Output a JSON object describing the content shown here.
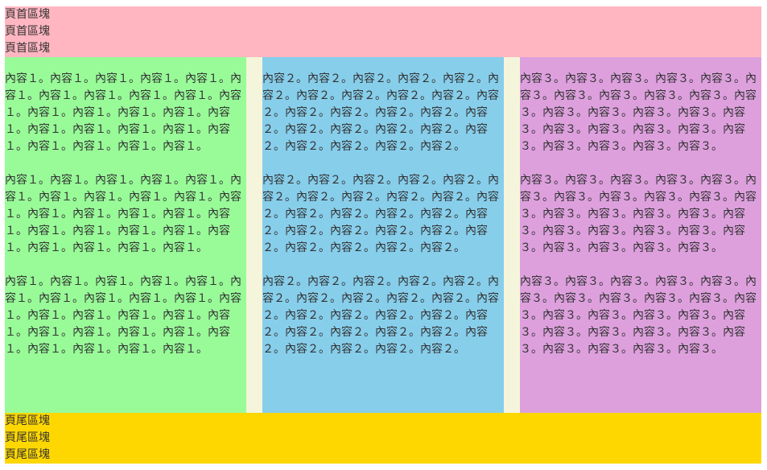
{
  "header": {
    "lines": [
      "頁首區塊",
      "頁首區塊",
      "頁首區塊"
    ],
    "color": "#ffb6c1"
  },
  "columns": [
    {
      "color": "#98fb98",
      "paragraphs": [
        "內容１。內容１。內容１。內容１。內容１。內容１。內容１。內容１。內容１。內容１。內容１。內容１。內容１。內容１。內容１。內容１。內容１。內容１。內容１。內容１。內容１。內容１。內容１。內容１。內容１。",
        "內容１。內容１。內容１。內容１。內容１。內容１。內容１。內容１。內容１。內容１。內容１。內容１。內容１。內容１。內容１。內容１。內容１。內容１。內容１。內容１。內容１。內容１。內容１。內容１。內容１。",
        "內容１。內容１。內容１。內容１。內容１。內容１。內容１。內容１。內容１。內容１。內容１。內容１。內容１。內容１。內容１。內容１。內容１。內容１。內容１。內容１。內容１。內容１。內容１。內容１。內容１。"
      ]
    },
    {
      "color": "#87ceeb",
      "paragraphs": [
        "內容２。內容２。內容２。內容２。內容２。內容２。內容２。內容２。內容２。內容２。內容２。內容２。內容２。內容２。內容２。內容２。內容２。內容２。內容２。內容２。內容２。內容２。內容２。內容２。內容２。",
        "內容２。內容２。內容２。內容２。內容２。內容２。內容２。內容２。內容２。內容２。內容２。內容２。內容２。內容２。內容２。內容２。內容２。內容２。內容２。內容２。內容２。內容２。內容２。內容２。內容２。",
        "內容２。內容２。內容２。內容２。內容２。內容２。內容２。內容２。內容２。內容２。內容２。內容２。內容２。內容２。內容２。內容２。內容２。內容２。內容２。內容２。內容２。內容２。內容２。內容２。內容２。"
      ]
    },
    {
      "color": "#dda0dd",
      "paragraphs": [
        "內容３。內容３。內容３。內容３。內容３。內容３。內容３。內容３。內容３。內容３。內容３。內容３。內容３。內容３。內容３。內容３。內容３。內容３。內容３。內容３。內容３。內容３。內容３。內容３。內容３。",
        "內容３。內容３。內容３。內容３。內容３。內容３。內容３。內容３。內容３。內容３。內容３。內容３。內容３。內容３。內容３。內容３。內容３。內容３。內容３。內容３。內容３。內容３。內容３。內容３。內容３。",
        "內容３。內容３。內容３。內容３。內容３。內容３。內容３。內容３。內容３。內容３。內容３。內容３。內容３。內容３。內容３。內容３。內容３。內容３。內容３。內容３。內容３。內容３。內容３。內容３。內容３。"
      ]
    }
  ],
  "main_background": "#f5f5dc",
  "footer": {
    "lines": [
      "頁尾區塊",
      "頁尾區塊",
      "頁尾區塊"
    ],
    "color": "#ffd700"
  }
}
